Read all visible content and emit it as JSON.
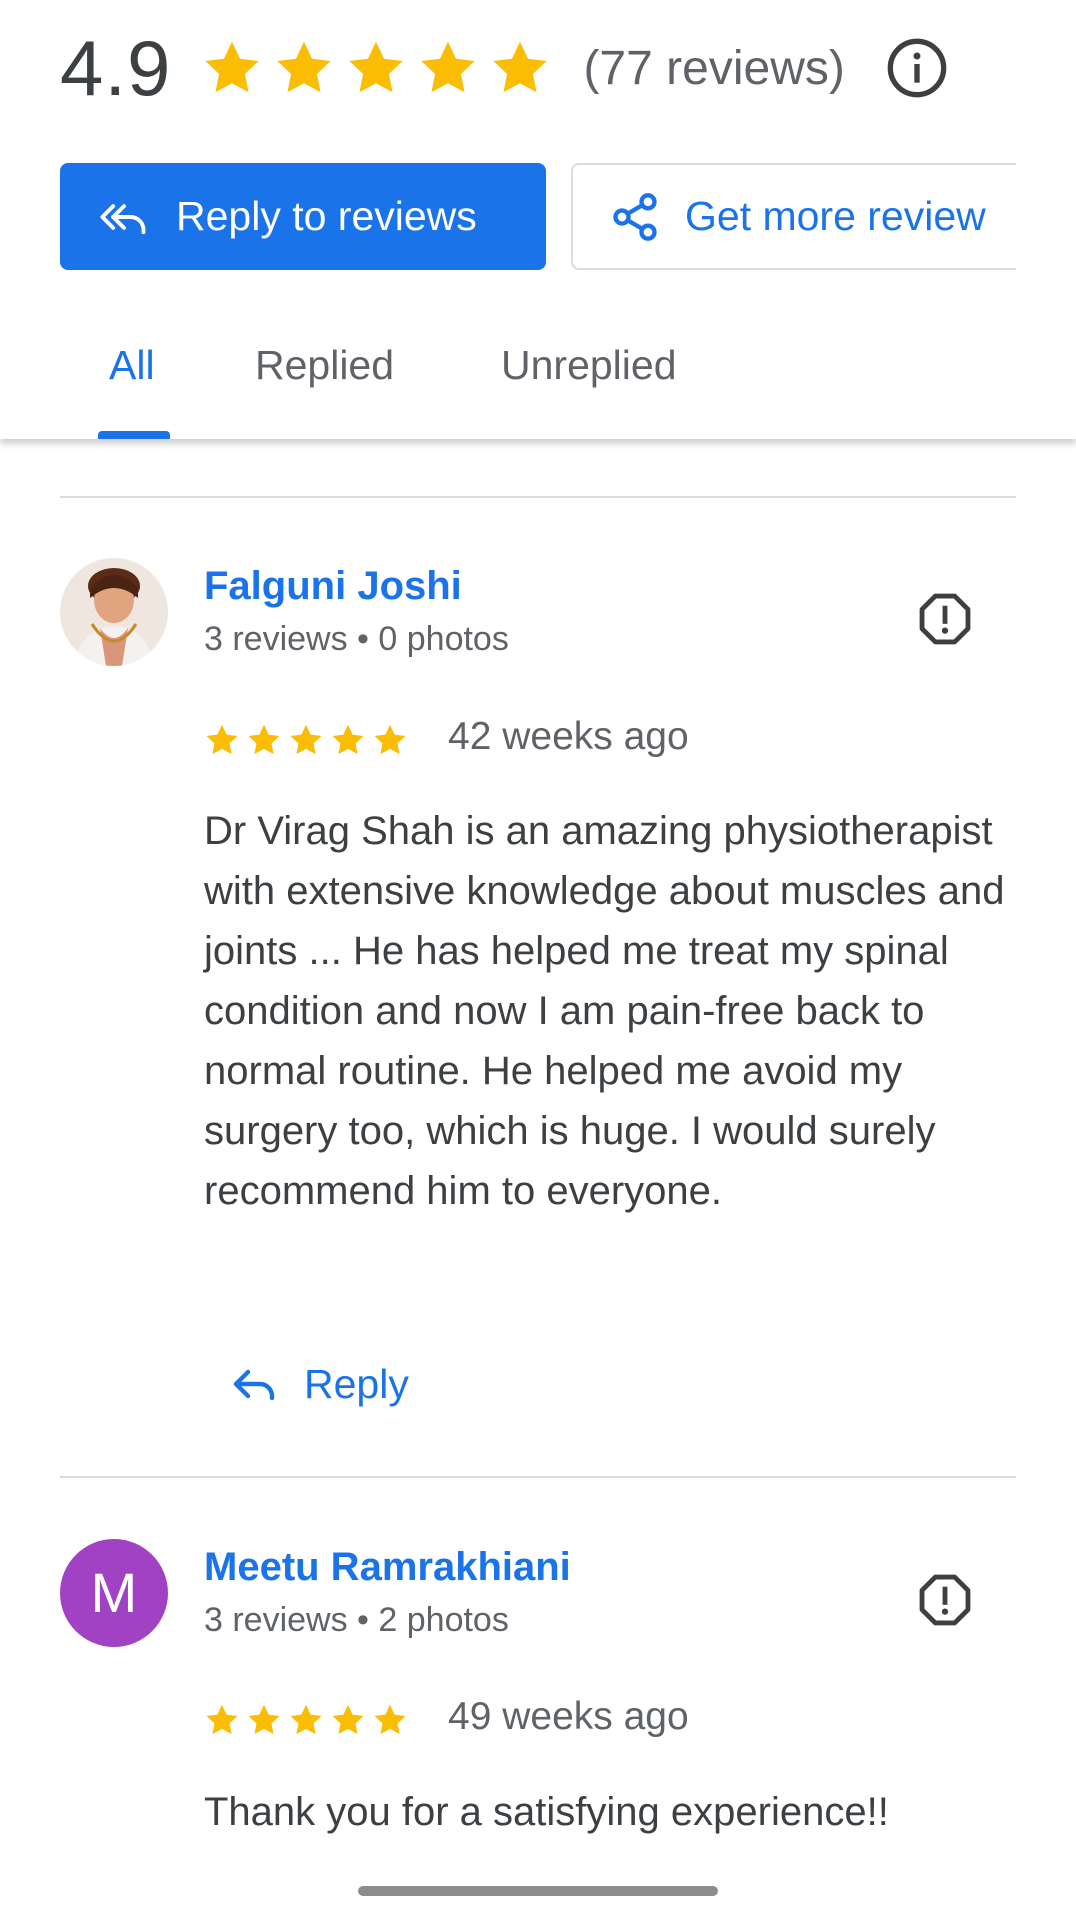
{
  "summary": {
    "rating": "4.9",
    "stars": 5,
    "review_count_text": "(77 reviews)",
    "info_icon": "info-icon"
  },
  "actions": {
    "reply_to_reviews_label": "Reply to reviews",
    "reply_to_reviews_icon": "reply-all-icon",
    "get_more_reviews_label": "Get more review",
    "get_more_reviews_icon": "share-icon"
  },
  "tabs": [
    {
      "label": "All",
      "active": true
    },
    {
      "label": "Replied",
      "active": false
    },
    {
      "label": "Unreplied",
      "active": false
    }
  ],
  "reviews": [
    {
      "name": "Falguni Joshi",
      "meta": "3 reviews • 0 photos",
      "avatar": "profile-photo",
      "stars": 5,
      "time": "42 weeks ago",
      "text": "Dr Virag Shah is an amazing physiotherapist with extensive knowledge about muscles and joints ... He has helped me treat my spinal condition and now I am pain-free back to normal routine. He helped me avoid my surgery too, which is huge. I would surely recommend him to everyone.",
      "reply_label": "Reply",
      "flag_icon": "flag-report-icon"
    },
    {
      "name": "Meetu Ramrakhiani",
      "meta": "3 reviews • 2 photos",
      "avatar_letter": "M",
      "stars": 5,
      "time": "49 weeks ago",
      "text": "Thank you for a satisfying experience!!",
      "flag_icon": "flag-report-icon"
    }
  ],
  "colors": {
    "accent": "#1a73e8",
    "star": "#fbbc04",
    "avatar_m": "#a142c4",
    "text": "#3c4043",
    "secondary_text": "#5f6368"
  }
}
